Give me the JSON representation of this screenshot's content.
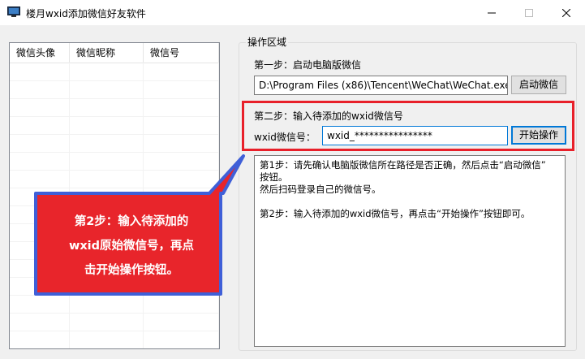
{
  "window": {
    "title": "楼月wxid添加微信好友软件"
  },
  "list": {
    "columns": [
      "微信头像",
      "微信昵称",
      "微信号"
    ]
  },
  "operation_area": {
    "title": "操作区域",
    "step1": {
      "label": "第一步：启动电脑版微信",
      "path_value": "D:\\Program Files (x86)\\Tencent\\WeChat\\WeChat.exe",
      "button": "启动微信"
    },
    "step2": {
      "label": "第二步：输入待添加的wxid微信号",
      "field_label": "wxid微信号：",
      "field_value": "wxid_****************",
      "button": "开始操作"
    },
    "log_lines": [
      "第1步：请先确认电脑版微信所在路径是否正确，然后点击“启动微信”",
      "按钮。",
      "然后扫码登录自己的微信号。",
      "",
      "第2步：输入待添加的wxid微信号，再点击“开始操作”按钮即可。"
    ]
  },
  "callout": {
    "lines": [
      "第2步：输入待添加的",
      "wxid原始微信号，再点",
      "击开始操作按钮。"
    ],
    "fill_color": "#e8252b",
    "border_color": "#3f5fd8"
  }
}
